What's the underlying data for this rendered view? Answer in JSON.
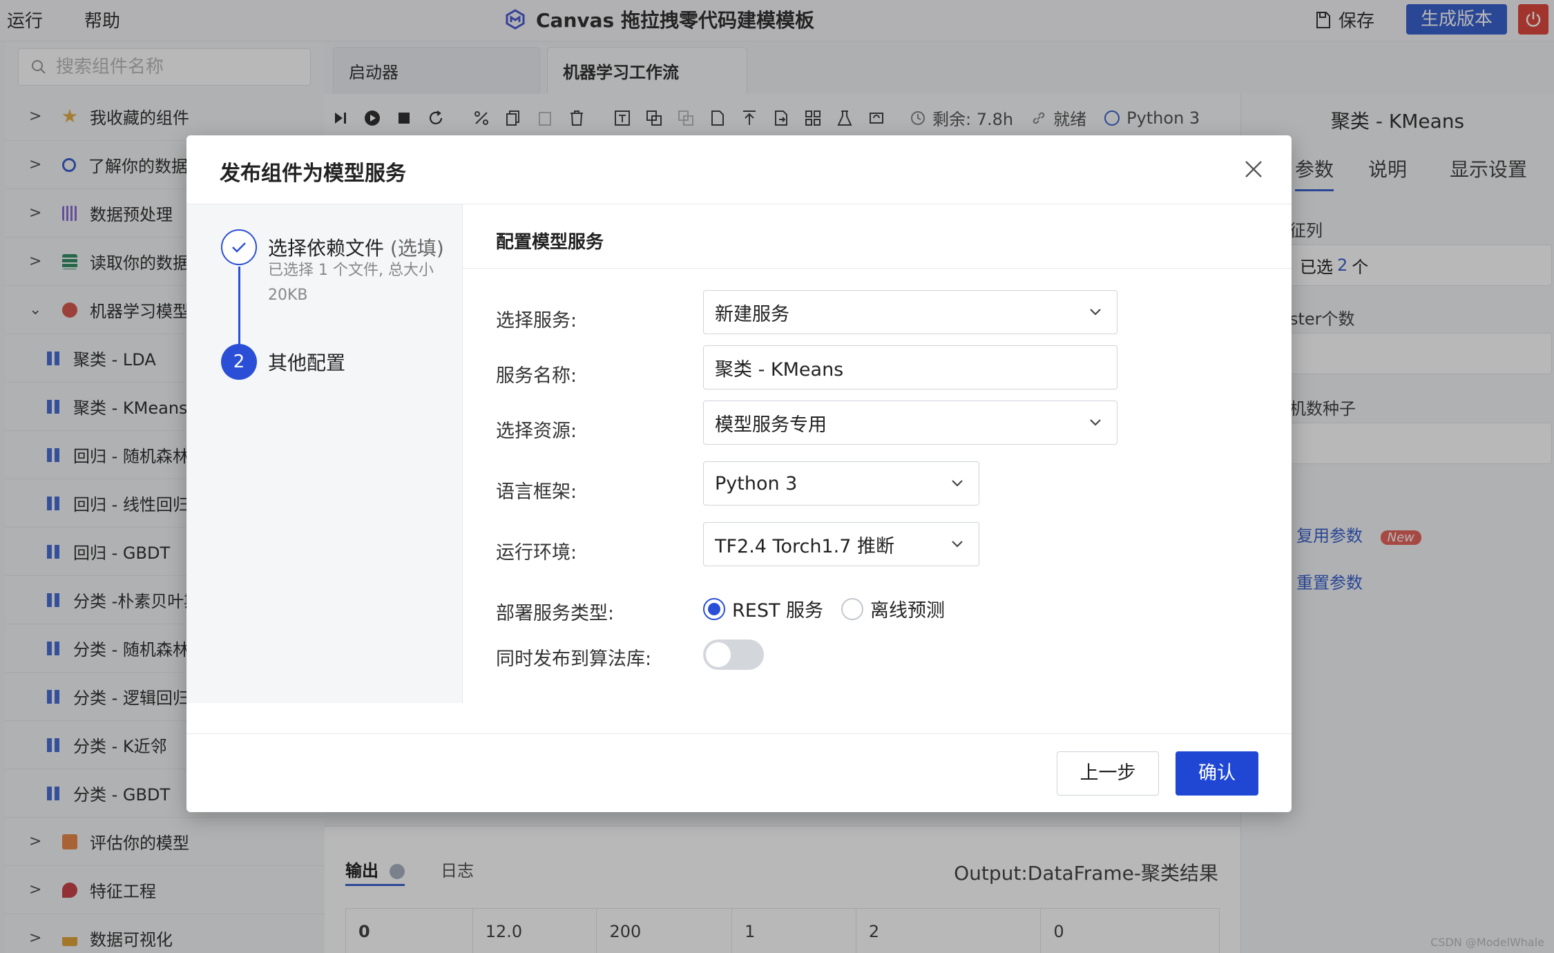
{
  "menu": {
    "run": "运行",
    "help": "帮助"
  },
  "app": {
    "title": "Canvas 拖拉拽零代码建模模板",
    "save": "保存",
    "generate": "生成版本"
  },
  "sidebar": {
    "search_placeholder": "搜索组件名称",
    "groups": [
      {
        "label": "我收藏的组件",
        "expanded": false
      },
      {
        "label": "了解你的数据",
        "expanded": false
      },
      {
        "label": "数据预处理",
        "expanded": false
      },
      {
        "label": "读取你的数据",
        "expanded": false
      },
      {
        "label": "机器学习模型",
        "expanded": true
      },
      {
        "label": "评估你的模型",
        "expanded": false
      },
      {
        "label": "特征工程",
        "expanded": false
      },
      {
        "label": "数据可视化",
        "expanded": false
      }
    ],
    "children": [
      "聚类 - LDA",
      "聚类 - KMeans",
      "回归 - 随机森林",
      "回归 - 线性回归",
      "回归 - GBDT",
      "分类 -朴素贝叶斯",
      "分类 - 随机森林",
      "分类 - 逻辑回归",
      "分类 - K近邻",
      "分类 - GBDT"
    ]
  },
  "tabs": [
    "启动器",
    "机器学习工作流"
  ],
  "toolbar": {
    "remaining": "剩余: 7.8h",
    "status": "就绪",
    "kernel": "Python 3"
  },
  "bottom": {
    "tab_output": "输出",
    "tab_log": "日志",
    "output_label": "Output:DataFrame-聚类结果",
    "row": [
      "0",
      "12.0",
      "200",
      "1",
      "2",
      "0"
    ]
  },
  "right_panel": {
    "title": "聚类 - KMeans",
    "tabs": [
      "参数",
      "说明",
      "显示设置"
    ],
    "labels": [
      "征列",
      "ster个数",
      "机数种子"
    ],
    "selected_prefix": "已选",
    "selected_count": "2",
    "selected_suffix": "个",
    "reuse": "复用参数",
    "new_badge": "New",
    "reset": "重置参数"
  },
  "modal": {
    "title": "发布组件为模型服务",
    "steps": [
      {
        "title": "选择依赖文件",
        "optional": "(选填)",
        "desc": "已选择 1 个文件, 总大小 20KB"
      },
      {
        "number": "2",
        "title": "其他配置"
      }
    ],
    "content_title": "配置模型服务",
    "form": {
      "service_label": "选择服务:",
      "service_value": "新建服务",
      "name_label": "服务名称:",
      "name_value": "聚类 - KMeans",
      "resource_label": "选择资源:",
      "resource_value": "模型服务专用",
      "framework_label": "语言框架:",
      "framework_value": "Python 3",
      "env_label": "运行环境:",
      "env_value": "TF2.4 Torch1.7 推断",
      "deploy_label": "部署服务类型:",
      "deploy_rest": "REST 服务",
      "deploy_offline": "离线预测",
      "publish_label": "同时发布到算法库:"
    },
    "prev": "上一步",
    "confirm": "确认"
  },
  "watermark": "CSDN @ModelWhale"
}
